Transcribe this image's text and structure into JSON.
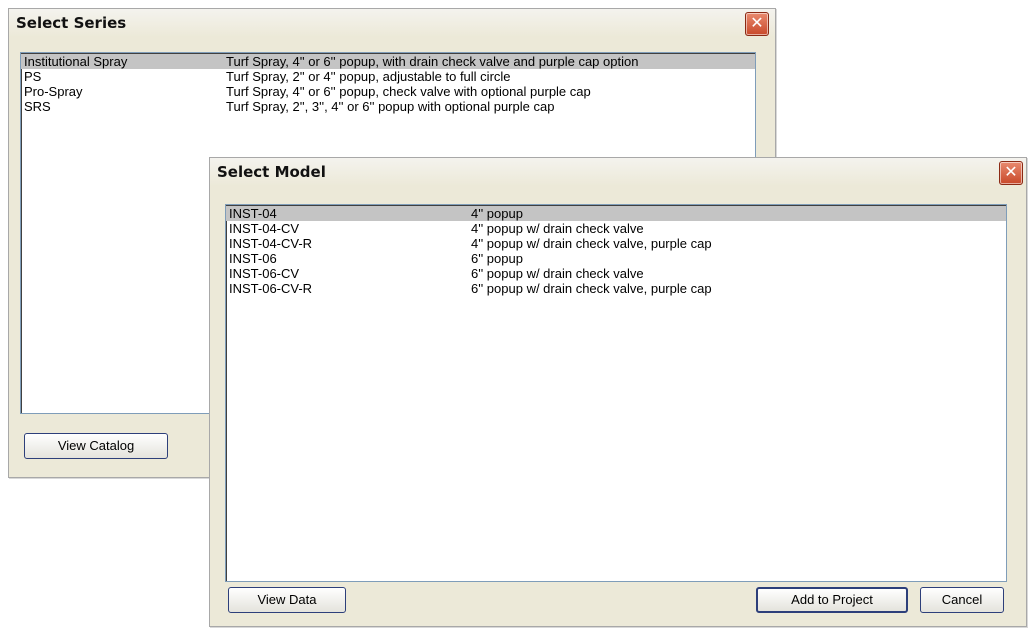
{
  "series_dialog": {
    "title": "Select Series",
    "close_glyph": "✕",
    "rows": [
      {
        "name": "Institutional Spray",
        "desc": "Turf Spray, 4'' or 6'' popup, with drain check valve and purple cap option",
        "selected": true
      },
      {
        "name": "PS",
        "desc": "Turf Spray, 2'' or 4'' popup, adjustable to full circle",
        "selected": false
      },
      {
        "name": "Pro-Spray",
        "desc": "Turf Spray, 4'' or 6'' popup, check valve with optional purple cap",
        "selected": false
      },
      {
        "name": "SRS",
        "desc": "Turf Spray, 2'', 3'', 4'' or 6'' popup with optional purple cap",
        "selected": false
      }
    ],
    "view_catalog_label": "View Catalog"
  },
  "model_dialog": {
    "title": "Select Model",
    "close_glyph": "✕",
    "rows": [
      {
        "name": "INST-04",
        "desc": "4'' popup",
        "selected": true
      },
      {
        "name": "INST-04-CV",
        "desc": "4'' popup w/ drain check valve",
        "selected": false
      },
      {
        "name": "INST-04-CV-R",
        "desc": "4'' popup w/ drain check valve, purple cap",
        "selected": false
      },
      {
        "name": "INST-06",
        "desc": "6'' popup",
        "selected": false
      },
      {
        "name": "INST-06-CV",
        "desc": "6'' popup w/ drain check valve",
        "selected": false
      },
      {
        "name": "INST-06-CV-R",
        "desc": "6'' popup w/ drain check valve, purple cap",
        "selected": false
      }
    ],
    "view_data_label": "View Data",
    "add_to_project_label": "Add to Project",
    "cancel_label": "Cancel"
  },
  "colors": {
    "selection": "#c4c4c4",
    "dialog_face": "#ece9d8",
    "close_button": "#c8482a"
  },
  "icons": {
    "close": "close-icon"
  }
}
